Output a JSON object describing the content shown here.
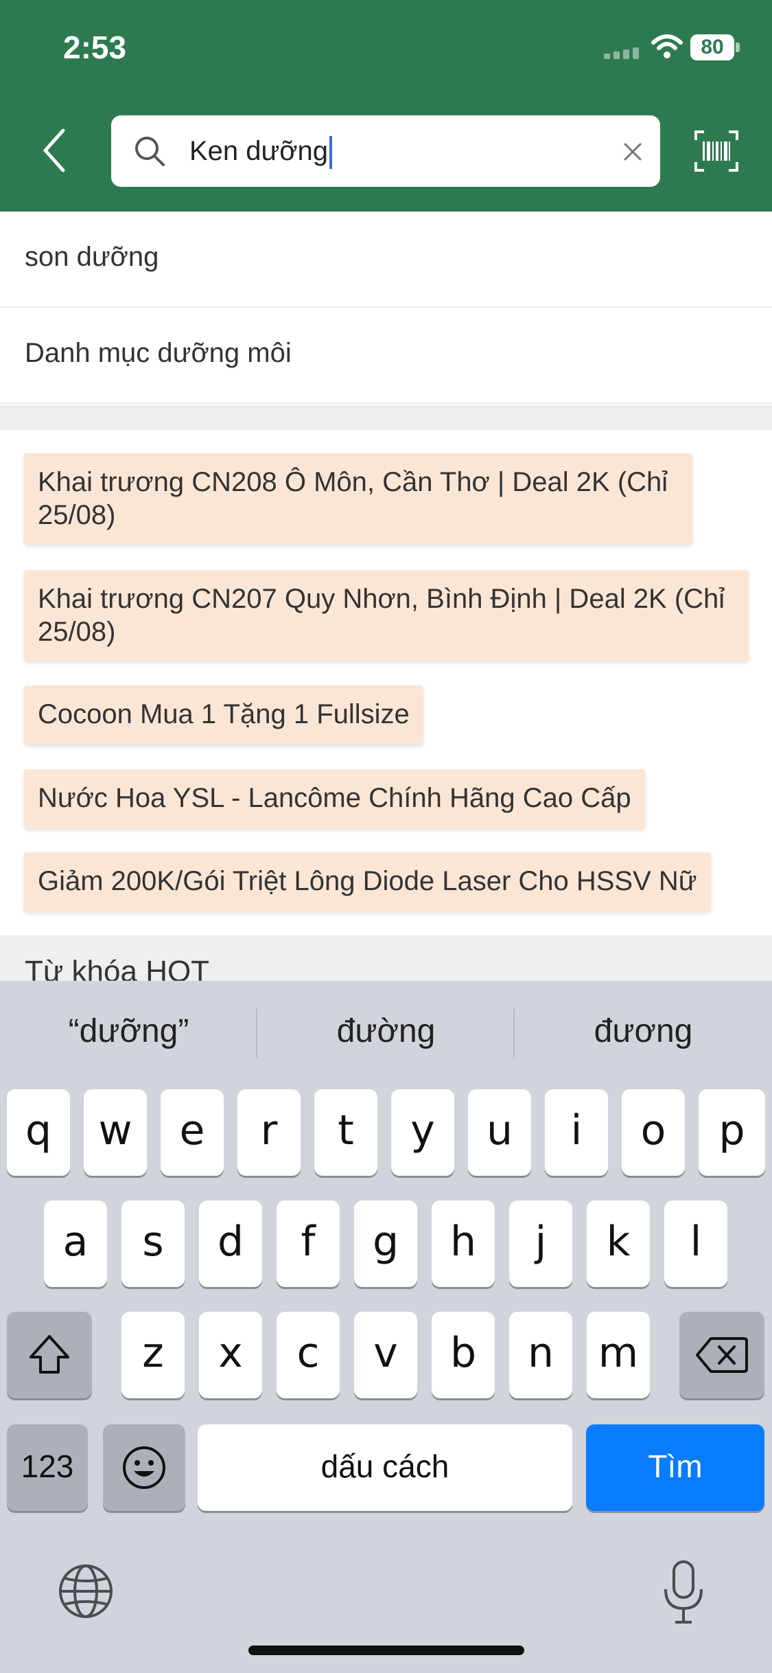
{
  "status_bar": {
    "time": "2:53",
    "battery": "80"
  },
  "header": {
    "search_value": "Ken dưỡng",
    "icons": {
      "back": "chevron-left-icon",
      "search": "search-icon",
      "clear": "close-icon",
      "barcode": "barcode-scan-icon"
    }
  },
  "suggestions": [
    {
      "label": "son dưỡng"
    },
    {
      "label": "Danh mục dưỡng môi"
    }
  ],
  "promotions": [
    {
      "label": "Khai trương CN208 Ô Môn, Cần Thơ | Deal 2K (Chỉ 25/08)"
    },
    {
      "label": "Khai trương CN207 Quy Nhơn, Bình Định | Deal 2K (Chỉ 25/08)"
    },
    {
      "label": "Cocoon Mua 1 Tặng 1 Fullsize"
    },
    {
      "label": "Nước Hoa YSL - Lancôme Chính Hãng Cao Cấp"
    },
    {
      "label": "Giảm 200K/Gói Triệt Lông Diode Laser Cho HSSV Nữ"
    }
  ],
  "hot_keywords": {
    "title": "Từ khóa HOT"
  },
  "keyboard": {
    "predictions": [
      "“dưỡng”",
      "đường",
      "đương"
    ],
    "row1": [
      "q",
      "w",
      "e",
      "r",
      "t",
      "y",
      "u",
      "i",
      "o",
      "p"
    ],
    "row2": [
      "a",
      "s",
      "d",
      "f",
      "g",
      "h",
      "j",
      "k",
      "l"
    ],
    "row3": [
      "z",
      "x",
      "c",
      "v",
      "b",
      "n",
      "m"
    ],
    "numbers_label": "123",
    "space_label": "dấu cách",
    "return_label": "Tìm",
    "icons": {
      "shift": "shift-icon",
      "delete": "backspace-icon",
      "emoji": "emoji-icon",
      "globe": "globe-icon",
      "mic": "microphone-icon"
    }
  },
  "colors": {
    "header_bg": "#2e7a50",
    "tag_bg": "#fbe6d6",
    "keyboard_bg": "#d1d4da",
    "return_key": "#0a7cff"
  }
}
